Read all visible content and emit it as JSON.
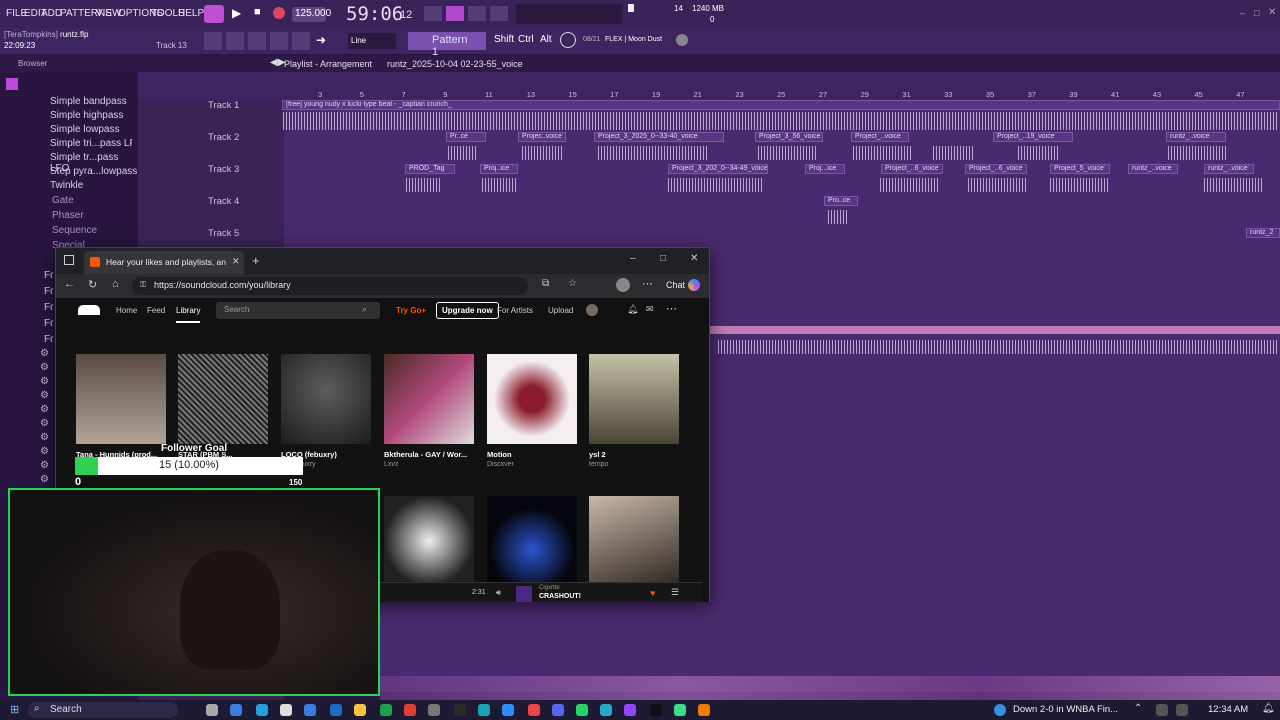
{
  "fl": {
    "menu": [
      "FILE",
      "EDIT",
      "ADD",
      "PATTERNS",
      "VIEW",
      "OPTIONS",
      "TOOLS",
      "HELP"
    ],
    "tempo": "125.000",
    "time": "59:06",
    "time_sub": "12",
    "mem": "1240 MB",
    "cpu": "14",
    "poly": "0",
    "user": "[TeraTompkins]",
    "file": "runtz.flp",
    "clock_small": "22:09:23",
    "track_hint": "Track 13",
    "line_mode": "Line",
    "pattern": "Pattern 1",
    "keys": [
      "Shift",
      "Ctrl",
      "Alt"
    ],
    "hint_num": "08/21",
    "hint_text": "FLEX | Moon Dust",
    "browser_label": "Browser",
    "playlist_title": "Playlist - Arrangement",
    "playlist_file": "runtz_2025-10-04 02-23-55_voice",
    "sidebar_items": [
      "Simple bandpass",
      "Simple highpass",
      "Simple lowpass",
      "Simple tri...pass LFO",
      "Simple tr...pass LFO",
      "Step pyra...lowpass",
      "Twinkle"
    ],
    "sidebar_folders": [
      "Gate",
      "Phaser",
      "Sequence",
      "Special"
    ],
    "sidebar_frags": [
      "Fr",
      "Fr",
      "Fr",
      "Fr",
      "Fr"
    ],
    "tracks": [
      "Track 1",
      "Track 2",
      "Track 3",
      "Track 4",
      "Track 5"
    ],
    "ruler": [
      "3",
      "5",
      "7",
      "9",
      "11",
      "13",
      "15",
      "17",
      "19",
      "21",
      "23",
      "25",
      "27",
      "29",
      "31",
      "33",
      "35",
      "37",
      "39",
      "41",
      "43",
      "45",
      "47"
    ],
    "clip_track1": "[free] young nudy x lucki type beat - _captian crunch_",
    "clips": [
      "Pr..ce",
      "Projec..voice",
      "Project_3_2025_0--33-40_voice",
      "Project_3_56_voice",
      "Project_..voice",
      "Project_..19_voice",
      "runtz_..voice",
      "PROD_Tag",
      "Proj..ice",
      "Project_3_202_0--34-49_voice",
      "Proj...ice",
      "Project_..6_voice",
      "Project_..6_voice",
      "Project_5_voice",
      "runtz_..voice",
      "runtz_..voice",
      "Pro..ce",
      "runtz_2"
    ]
  },
  "browser": {
    "tab_title": "Hear your likes and playlists, and",
    "url": "https://soundcloud.com/you/library",
    "chat": "Chat",
    "nav": [
      "Home",
      "Feed",
      "Library"
    ],
    "search_placeholder": "Search",
    "try_go": "Try Go+",
    "upgrade": "Upgrade now",
    "for_artists": "For Artists",
    "upload": "Upload",
    "cards": [
      {
        "title": "Tana - Hunnids (prod...",
        "sub": ""
      },
      {
        "title": "STAR (PBM S...",
        "sub": ""
      },
      {
        "title": "LOCO (febuxry)",
        "sub": "O, Febuxry"
      },
      {
        "title": "Bktherula - GAY / Wor...",
        "sub": "Lxvz"
      },
      {
        "title": "Motion",
        "sub": "Discxver"
      },
      {
        "title": "ysl 2",
        "sub": "tempo"
      }
    ],
    "player_time": "2:31",
    "player_artist": "Cigxrtte",
    "player_track": "CRASHOUT!"
  },
  "overlay": {
    "goal_title": "Follower Goal",
    "goal_value": "15 (10.00%)",
    "goal_min": "0",
    "goal_max": "150",
    "goal_progress": 0.1
  },
  "taskbar": {
    "search": "Search",
    "news": "Down 2-0 in WNBA Fin...",
    "clock": "12:34 AM"
  },
  "colors": {
    "accent": "#1fd655",
    "fl_bg": "#4a2a6e",
    "sc_orange": "#ff5500"
  }
}
